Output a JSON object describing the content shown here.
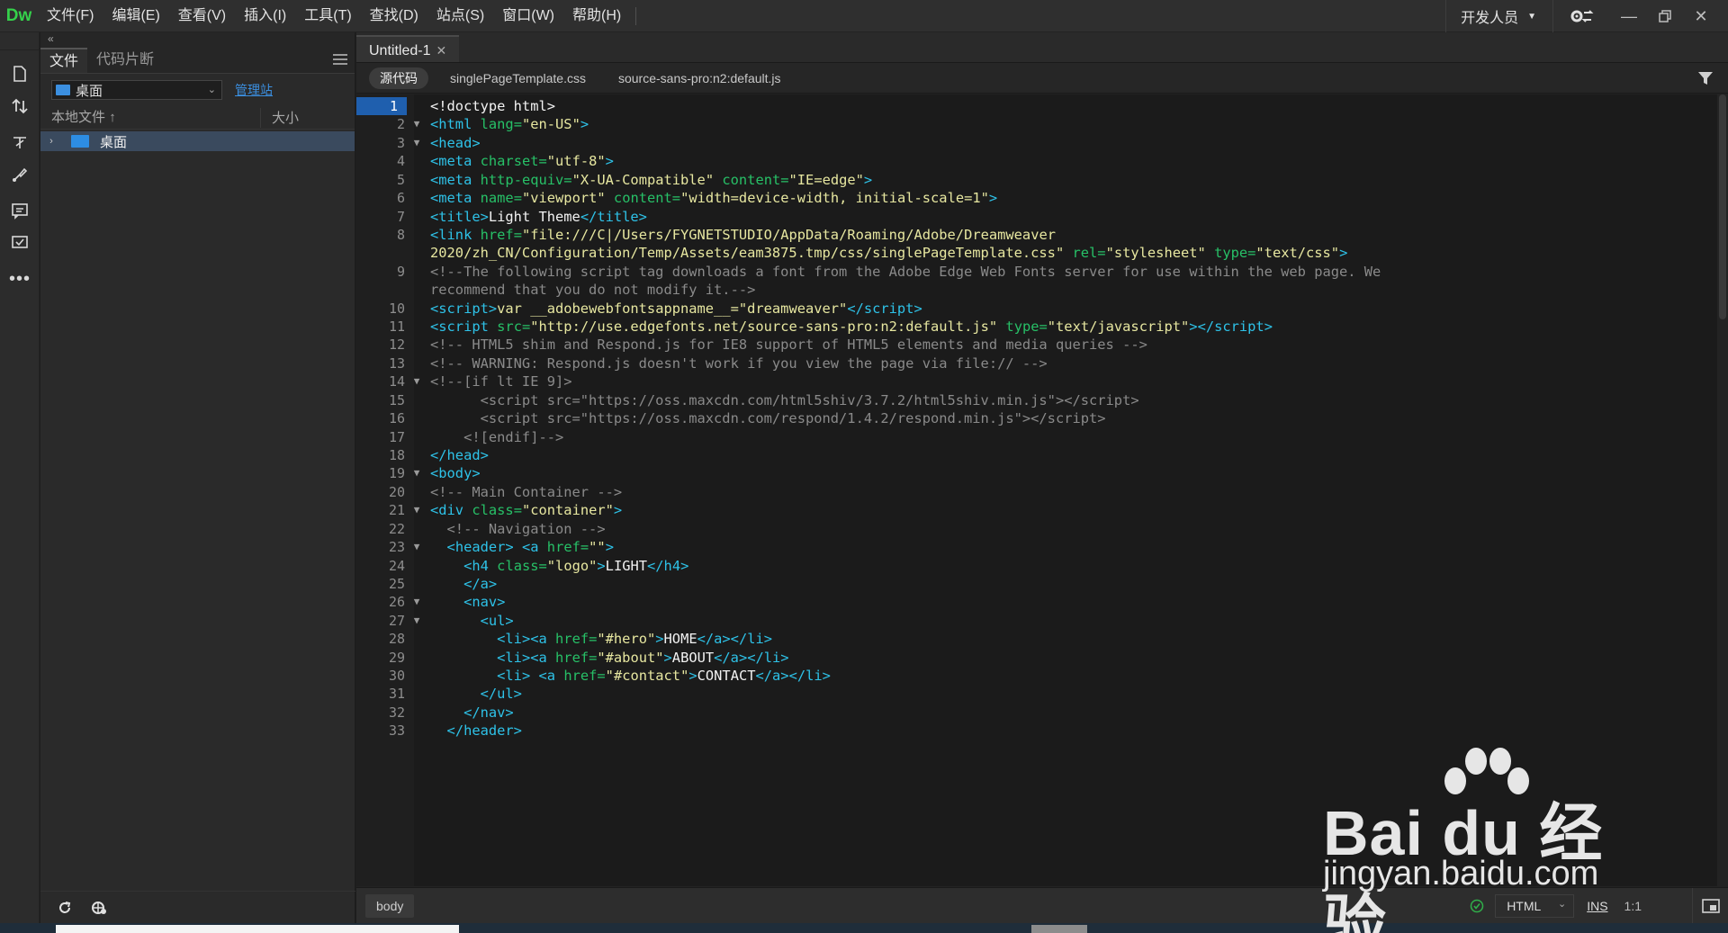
{
  "app": {
    "logo": "Dw"
  },
  "menu": [
    "文件(F)",
    "编辑(E)",
    "查看(V)",
    "插入(I)",
    "工具(T)",
    "查找(D)",
    "站点(S)",
    "窗口(W)",
    "帮助(H)"
  ],
  "workspace": {
    "label": "开发人员"
  },
  "files_panel": {
    "collapse": "«",
    "tabs": [
      "文件",
      "代码片断"
    ],
    "site": "桌面",
    "manage_link": "管理站",
    "col_local": "本地文件",
    "col_size": "大小",
    "tree_item": "桌面"
  },
  "document": {
    "tab": "Untitled-1",
    "related_files": [
      "源代码",
      "singlePageTemplate.css",
      "source-sans-pro:n2:default.js"
    ]
  },
  "code_lines": [
    {
      "n": "1",
      "fold": "",
      "html": "<span class=\"s\">&lt;!doctype html&gt;</span>"
    },
    {
      "n": "2",
      "fold": "▼",
      "html": "<span class=\"t\">&lt;html</span> <span class=\"a\">lang=</span><span class=\"v\">\"en-US\"</span><span class=\"t\">&gt;</span>"
    },
    {
      "n": "3",
      "fold": "▼",
      "html": "<span class=\"t\">&lt;head&gt;</span>"
    },
    {
      "n": "4",
      "fold": "",
      "html": "<span class=\"t\">&lt;meta</span> <span class=\"a\">charset=</span><span class=\"v\">\"utf-8\"</span><span class=\"t\">&gt;</span>"
    },
    {
      "n": "5",
      "fold": "",
      "html": "<span class=\"t\">&lt;meta</span> <span class=\"a\">http-equiv=</span><span class=\"v\">\"X-UA-Compatible\"</span> <span class=\"a\">content=</span><span class=\"v\">\"IE=edge\"</span><span class=\"t\">&gt;</span>"
    },
    {
      "n": "6",
      "fold": "",
      "html": "<span class=\"t\">&lt;meta</span> <span class=\"a\">name=</span><span class=\"v\">\"viewport\"</span> <span class=\"a\">content=</span><span class=\"v\">\"width=device-width, initial-scale=1\"</span><span class=\"t\">&gt;</span>"
    },
    {
      "n": "7",
      "fold": "",
      "html": "<span class=\"t\">&lt;title&gt;</span><span class=\"s\">Light Theme</span><span class=\"t\">&lt;/title&gt;</span>"
    },
    {
      "n": "8",
      "fold": "",
      "html": "<span class=\"t\">&lt;link</span> <span class=\"a\">href=</span><span class=\"v\">\"file:///C|/Users/FYGNETSTUDIO/AppData/Roaming/Adobe/Dreamweaver</span>"
    },
    {
      "n": "",
      "fold": "",
      "html": "<span class=\"v\">2020/zh_CN/Configuration/Temp/Assets/eam3875.tmp/css/singlePageTemplate.css\"</span> <span class=\"a\">rel=</span><span class=\"v\">\"stylesheet\"</span> <span class=\"a\">type=</span><span class=\"v\">\"text/css\"</span><span class=\"t\">&gt;</span>"
    },
    {
      "n": "9",
      "fold": "",
      "html": "<span class=\"c\">&lt;!--The following script tag downloads a font from the Adobe Edge Web Fonts server for use within the web page. We</span>"
    },
    {
      "n": "",
      "fold": "",
      "html": "<span class=\"c\">recommend that you do not modify it.--&gt;</span>"
    },
    {
      "n": "10",
      "fold": "",
      "html": "<span class=\"t\">&lt;script&gt;</span><span class=\"v\">var __adobewebfontsappname__=\"dreamweaver\"</span><span class=\"t\">&lt;/script&gt;</span>"
    },
    {
      "n": "11",
      "fold": "",
      "html": "<span class=\"t\">&lt;script</span> <span class=\"a\">src=</span><span class=\"v\">\"http://use.edgefonts.net/source-sans-pro:n2:default.js\"</span> <span class=\"a\">type=</span><span class=\"v\">\"text/javascript\"</span><span class=\"t\">&gt;&lt;/script&gt;</span>"
    },
    {
      "n": "12",
      "fold": "",
      "html": "<span class=\"c\">&lt;!-- HTML5 shim and Respond.js for IE8 support of HTML5 elements and media queries --&gt;</span>"
    },
    {
      "n": "13",
      "fold": "",
      "html": "<span class=\"c\">&lt;!-- WARNING: Respond.js doesn't work if you view the page via file:// --&gt;</span>"
    },
    {
      "n": "14",
      "fold": "▼",
      "html": "<span class=\"c\">&lt;!--[if lt IE 9]&gt;</span>"
    },
    {
      "n": "15",
      "fold": "",
      "html": "<span class=\"c\">      &lt;script src=\"https://oss.maxcdn.com/html5shiv/3.7.2/html5shiv.min.js\"&gt;&lt;/script&gt;</span>"
    },
    {
      "n": "16",
      "fold": "",
      "html": "<span class=\"c\">      &lt;script src=\"https://oss.maxcdn.com/respond/1.4.2/respond.min.js\"&gt;&lt;/script&gt;</span>"
    },
    {
      "n": "17",
      "fold": "",
      "html": "<span class=\"c\">    &lt;![endif]--&gt;</span>"
    },
    {
      "n": "18",
      "fold": "",
      "html": "<span class=\"t\">&lt;/head&gt;</span>"
    },
    {
      "n": "19",
      "fold": "▼",
      "html": "<span class=\"t\">&lt;body&gt;</span>"
    },
    {
      "n": "20",
      "fold": "",
      "html": "<span class=\"c\">&lt;!-- Main Container --&gt;</span>"
    },
    {
      "n": "21",
      "fold": "▼",
      "html": "<span class=\"t\">&lt;div</span> <span class=\"a\">class=</span><span class=\"v\">\"container\"</span><span class=\"t\">&gt;</span>"
    },
    {
      "n": "22",
      "fold": "",
      "html": "<span class=\"c\">  &lt;!-- Navigation --&gt;</span>"
    },
    {
      "n": "23",
      "fold": "▼",
      "html": "  <span class=\"t\">&lt;header&gt;</span> <span class=\"t\">&lt;a</span> <span class=\"a\">href=</span><span class=\"v\">\"\"</span><span class=\"t\">&gt;</span>"
    },
    {
      "n": "24",
      "fold": "",
      "html": "    <span class=\"t\">&lt;h4</span> <span class=\"a\">class=</span><span class=\"v\">\"logo\"</span><span class=\"t\">&gt;</span><span class=\"s\">LIGHT</span><span class=\"t\">&lt;/h4&gt;</span>"
    },
    {
      "n": "25",
      "fold": "",
      "html": "    <span class=\"t\">&lt;/a&gt;</span>"
    },
    {
      "n": "26",
      "fold": "▼",
      "html": "    <span class=\"t\">&lt;nav&gt;</span>"
    },
    {
      "n": "27",
      "fold": "▼",
      "html": "      <span class=\"t\">&lt;ul&gt;</span>"
    },
    {
      "n": "28",
      "fold": "",
      "html": "        <span class=\"t\">&lt;li&gt;&lt;a</span> <span class=\"a\">href=</span><span class=\"v\">\"#hero\"</span><span class=\"t\">&gt;</span><span class=\"s\">HOME</span><span class=\"t\">&lt;/a&gt;&lt;/li&gt;</span>"
    },
    {
      "n": "29",
      "fold": "",
      "html": "        <span class=\"t\">&lt;li&gt;&lt;a</span> <span class=\"a\">href=</span><span class=\"v\">\"#about\"</span><span class=\"t\">&gt;</span><span class=\"s\">ABOUT</span><span class=\"t\">&lt;/a&gt;&lt;/li&gt;</span>"
    },
    {
      "n": "30",
      "fold": "",
      "html": "        <span class=\"t\">&lt;li&gt;</span> <span class=\"t\">&lt;a</span> <span class=\"a\">href=</span><span class=\"v\">\"#contact\"</span><span class=\"t\">&gt;</span><span class=\"s\">CONTACT</span><span class=\"t\">&lt;/a&gt;&lt;/li&gt;</span>"
    },
    {
      "n": "31",
      "fold": "",
      "html": "      <span class=\"t\">&lt;/ul&gt;</span>"
    },
    {
      "n": "32",
      "fold": "",
      "html": "    <span class=\"t\">&lt;/nav&gt;</span>"
    },
    {
      "n": "33",
      "fold": "",
      "html": "  <span class=\"t\">&lt;/header&gt;</span>"
    }
  ],
  "status": {
    "tag": "body",
    "language": "HTML",
    "mode": "INS",
    "position": "1:1"
  },
  "watermark": {
    "line1": "Bai du 经验",
    "line2": "jingyan.baidu.com"
  },
  "colors": {
    "logo": "#35d14b",
    "tag": "#2ec2e8",
    "attr": "#27c067",
    "value": "#e7e7a0",
    "comment": "#8a8a8a",
    "selection": "#1f5fae"
  }
}
